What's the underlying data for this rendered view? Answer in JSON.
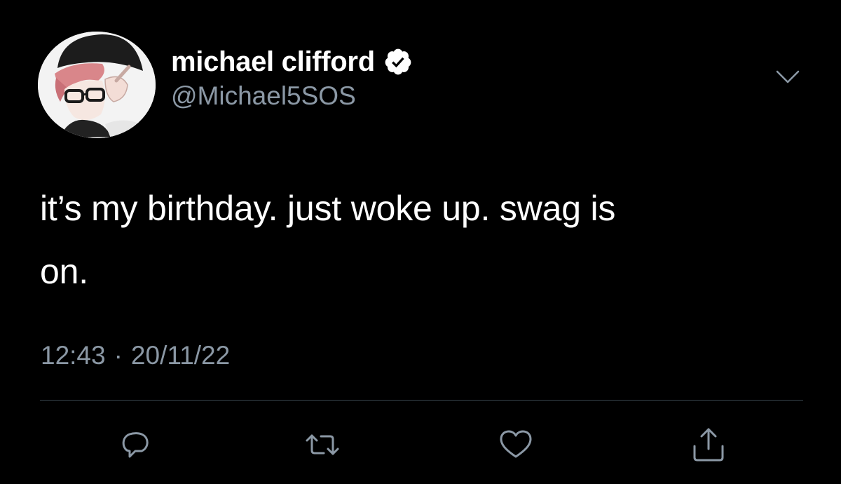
{
  "tweet": {
    "author": {
      "display_name": "michael clifford",
      "handle": "@Michael5SOS",
      "verified": true
    },
    "text_line1": "it’s my birthday. just woke up. swag is",
    "text_line2": "on.",
    "time": "12:43",
    "separator": "·",
    "date": "20/11/22"
  },
  "icons": {
    "menu": "chevron-down-icon",
    "reply": "reply-icon",
    "retweet": "retweet-icon",
    "like": "heart-icon",
    "share": "share-icon",
    "verified": "verified-badge-icon"
  },
  "colors": {
    "background": "#000000",
    "text": "#ffffff",
    "secondary": "#8b98a5",
    "divider": "#38444d",
    "verified_badge": "#ffffff"
  }
}
